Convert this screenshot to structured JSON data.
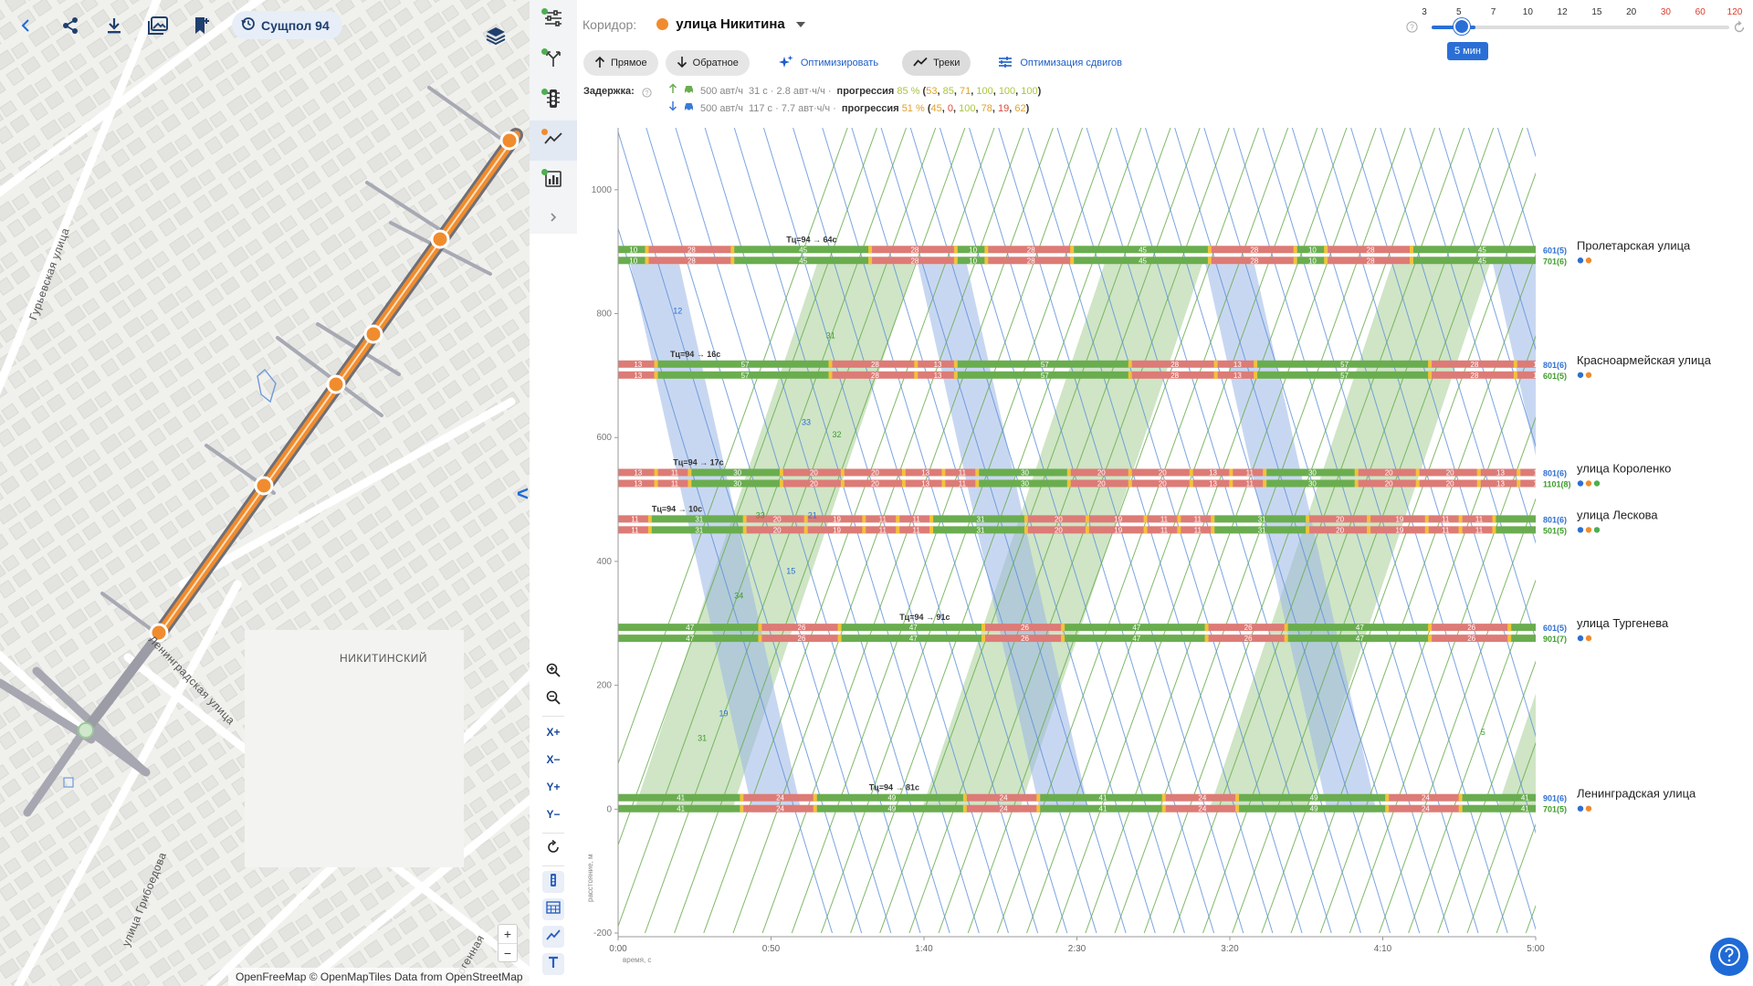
{
  "map": {
    "scenario": "Сущпол 94",
    "streets": [
      {
        "name": "Гурьевская улица",
        "x": 54,
        "y": 300,
        "angle": -70
      },
      {
        "name": "Ленинградская улица",
        "x": 210,
        "y": 745,
        "angle": 46
      },
      {
        "name": "НИКИТИНСКИЙ",
        "x": 420,
        "y": 721,
        "angle": 0
      },
      {
        "name": "улица Грибоедова",
        "x": 158,
        "y": 985,
        "angle": -68
      },
      {
        "name": "тогенная",
        "x": 514,
        "y": 1048,
        "angle": -60
      }
    ],
    "zoom_in": "+",
    "zoom_out": "−",
    "attribution": {
      "openfreemap": "OpenFreeMap",
      "copy": " © ",
      "openmaptiles": "OpenMapTiles",
      "data_from": " Data from ",
      "osm": "OpenStreetMap"
    }
  },
  "tools": {
    "zoom_x_in": "X+",
    "zoom_x_out": "X−",
    "zoom_y_in": "Y+",
    "zoom_y_out": "Y−",
    "collapse": "<>"
  },
  "header": {
    "corridor_label": "Коридор:",
    "corridor_name": "улица Никитина",
    "buttons": {
      "forward": "Прямое",
      "backward": "Обратное",
      "optimize": "Оптимизировать",
      "tracks": "Треки",
      "offset_opt": "Оптимизация сдвигов"
    },
    "delay_label": "Задержка:",
    "delay_forward": {
      "flow": "500 авт/ч",
      "delay": "31 с · 2.8 авт·ч/ч ·",
      "prog_label": "прогрессия",
      "prog_value": "85 %",
      "open": "(",
      "v1": "53",
      "v2": "85",
      "v3": "71",
      "v4": "100",
      "v5": "100",
      "v6": "100",
      "close": ")"
    },
    "delay_backward": {
      "flow": "500 авт/ч",
      "delay": "117 с · 7.7 авт·ч/ч ·",
      "prog_label": "прогрессия",
      "prog_value": "51 %",
      "open": "(",
      "v1": "45",
      "v2": "0",
      "v3": "100",
      "v4": "78",
      "v5": "19",
      "v6": "62",
      "close": ")"
    }
  },
  "slider": {
    "ticks": [
      "3",
      "5",
      "7",
      "10",
      "12",
      "15",
      "20",
      "30",
      "60",
      "120"
    ],
    "red_ticks": [
      "30",
      "60",
      "120"
    ],
    "value_label": "5 мин"
  },
  "chart_data": {
    "type": "time-space-diagram",
    "xlabel": "время, с",
    "ylabel": "расстояние, м",
    "xlim": [
      0,
      300
    ],
    "ylim": [
      -200,
      1100
    ],
    "x_ticks": [
      "0:00",
      "0:50",
      "1:40",
      "2:30",
      "3:20",
      "4:10",
      "5:00"
    ],
    "x_tick_values": [
      0,
      50,
      100,
      150,
      200,
      250,
      300
    ],
    "y_ticks": [
      -200,
      0,
      200,
      400,
      600,
      800,
      1000
    ],
    "colors": {
      "green": "#6aad4f",
      "red": "#dd7b76",
      "yellow": "#f3c23a",
      "blue": "#5a8fd8",
      "blue_band": "#9bb7e6",
      "green_band": "#a7cf97"
    },
    "cycle": 94,
    "intersections": [
      {
        "name": "Пролетарская улица",
        "pos": 880,
        "colors": [
          "#2e6fd0",
          "#f08c2e"
        ],
        "lanes": [
          {
            "label": "601(5)",
            "label_color": "blue",
            "offset": 64,
            "phases": [
              [
                "g",
                10
              ],
              [
                "r",
                28
              ],
              [
                "g",
                45
              ],
              [
                "r",
                28
              ]
            ]
          },
          {
            "label": "701(6)",
            "label_color": "green",
            "offset": 64,
            "phases": [
              [
                "g",
                10
              ],
              [
                "r",
                28
              ],
              [
                "g",
                45
              ],
              [
                "r",
                28
              ]
            ]
          }
        ],
        "tc_label": "Тц=94 → 64с",
        "tc_x": 55
      },
      {
        "name": "Красноармейская улица",
        "pos": 695,
        "colors": [
          "#2e6fd0",
          "#f08c2e"
        ],
        "lanes": [
          {
            "label": "801(6)",
            "label_color": "blue",
            "phases": [
              [
                "r",
                13
              ],
              [
                "g",
                57
              ],
              [
                "r",
                28
              ]
            ]
          },
          {
            "label": "601(5)",
            "label_color": "green",
            "phases": [
              [
                "r",
                13
              ],
              [
                "g",
                57
              ],
              [
                "r",
                28
              ]
            ]
          }
        ],
        "tc_label": "Тц=94 → 16с",
        "tc_x": 17
      },
      {
        "name": "улица Короленко",
        "pos": 520,
        "colors": [
          "#2e6fd0",
          "#f08c2e",
          "#4caf50"
        ],
        "lanes": [
          {
            "label": "801(6)",
            "label_color": "blue",
            "phases": [
              [
                "r",
                13
              ],
              [
                "r",
                11
              ],
              [
                "g",
                30
              ],
              [
                "r",
                20
              ],
              [
                "r",
                20
              ]
            ]
          },
          {
            "label": "1101(8)",
            "label_color": "green",
            "phases": [
              [
                "r",
                13
              ],
              [
                "r",
                11
              ],
              [
                "g",
                30
              ],
              [
                "r",
                20
              ],
              [
                "r",
                20
              ]
            ]
          }
        ],
        "tc_label": "Тц=94 → 17с",
        "tc_x": 18
      },
      {
        "name": "улица Лескова",
        "pos": 445,
        "colors": [
          "#2e6fd0",
          "#f08c2e",
          "#4caf50"
        ],
        "lanes": [
          {
            "label": "801(6)",
            "label_color": "blue",
            "phases": [
              [
                "r",
                11
              ],
              [
                "g",
                31
              ],
              [
                "r",
                20
              ],
              [
                "r",
                19
              ],
              [
                "r",
                11
              ]
            ]
          },
          {
            "label": "501(5)",
            "label_color": "green",
            "phases": [
              [
                "r",
                11
              ],
              [
                "g",
                31
              ],
              [
                "r",
                20
              ],
              [
                "r",
                19
              ],
              [
                "r",
                11
              ]
            ]
          }
        ],
        "tc_label": "Тц=94 → 10с",
        "tc_x": 11
      },
      {
        "name": "улица Тургенева",
        "pos": 270,
        "colors": [
          "#2e6fd0",
          "#f08c2e"
        ],
        "lanes": [
          {
            "label": "601(5)",
            "label_color": "blue",
            "phases": [
              [
                "g",
                47
              ],
              [
                "r",
                26
              ]
            ]
          },
          {
            "label": "901(7)",
            "label_color": "green",
            "phases": [
              [
                "g",
                47
              ],
              [
                "r",
                26
              ]
            ]
          }
        ],
        "tc_label": "Тц=94 → 91с",
        "tc_x": 92
      },
      {
        "name": "Ленинградская улица",
        "pos": -5,
        "colors": [
          "#2e6fd0",
          "#f08c2e"
        ],
        "lanes": [
          {
            "label": "901(6)",
            "label_color": "blue",
            "phases": [
              [
                "g",
                41
              ],
              [
                "r",
                24
              ],
              [
                "g",
                49
              ],
              [
                "r",
                24
              ]
            ]
          },
          {
            "label": "701(5)",
            "label_color": "green",
            "phases": [
              [
                "g",
                41
              ],
              [
                "r",
                24
              ],
              [
                "g",
                49
              ],
              [
                "r",
                24
              ]
            ]
          }
        ],
        "tc_label": "Тц=94 → 81с",
        "tc_x": 82
      }
    ],
    "band_labels_blue": [
      "12",
      "33",
      "21",
      "15",
      "19"
    ],
    "band_labels_green": [
      "31",
      "32",
      "33",
      "34",
      "31",
      "5"
    ]
  }
}
